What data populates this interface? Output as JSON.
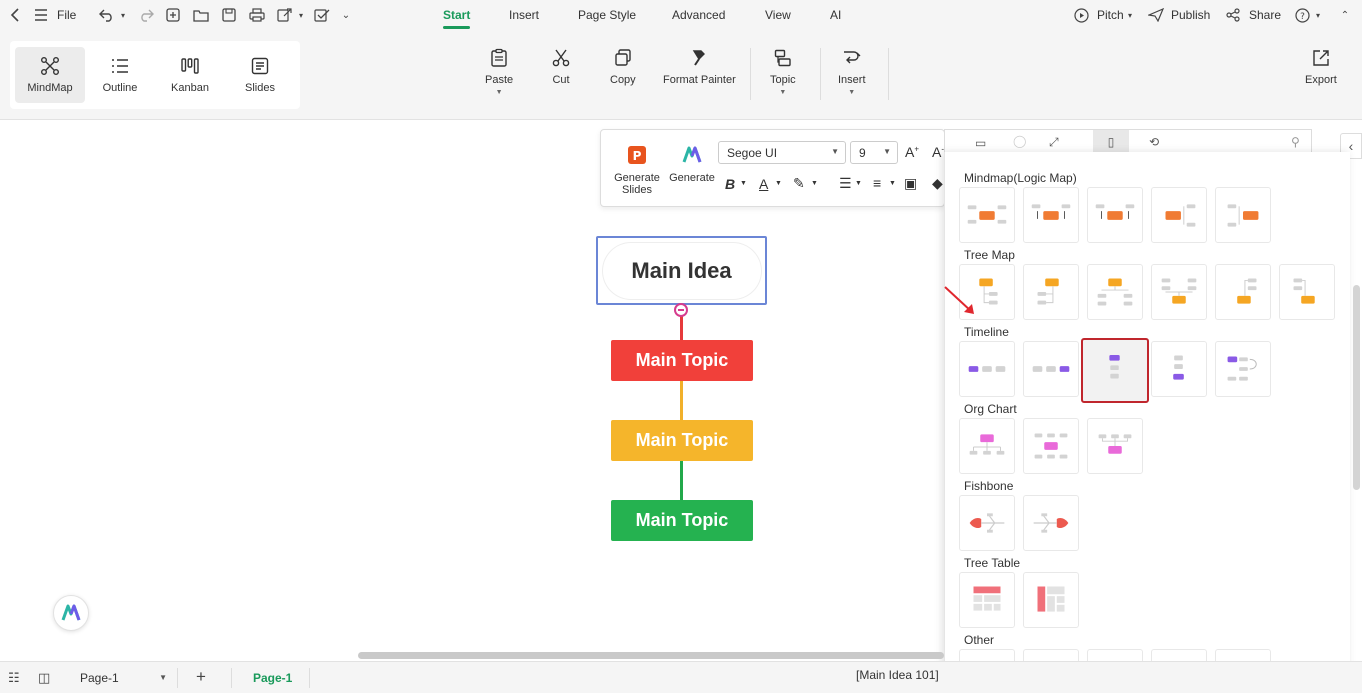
{
  "menu": {
    "file_label": "File",
    "tabs": [
      {
        "label": "Start",
        "active": true
      },
      {
        "label": "Insert"
      },
      {
        "label": "Page Style"
      },
      {
        "label": "Advanced"
      },
      {
        "label": "View"
      },
      {
        "label": "AI"
      }
    ],
    "pitch_label": "Pitch",
    "publish_label": "Publish",
    "share_label": "Share"
  },
  "views": [
    {
      "label": "MindMap",
      "icon": "mindmap-icon",
      "active": true
    },
    {
      "label": "Outline",
      "icon": "outline-icon"
    },
    {
      "label": "Kanban",
      "icon": "kanban-icon"
    },
    {
      "label": "Slides",
      "icon": "slides-icon"
    }
  ],
  "ribbon": {
    "paste": "Paste",
    "cut": "Cut",
    "copy": "Copy",
    "format_painter": "Format Painter",
    "topic": "Topic",
    "insert": "Insert",
    "export": "Export"
  },
  "floatbar": {
    "generate_slides": "Generate Slides",
    "generate": "Generate",
    "font": "Segoe UI",
    "size": "9"
  },
  "mindmap": {
    "main_idea": "Main Idea",
    "topics": [
      {
        "label": "Main Topic",
        "color": "#f1403a"
      },
      {
        "label": "Main Topic",
        "color": "#f5b52b"
      },
      {
        "label": "Main Topic",
        "color": "#25b250"
      }
    ],
    "line_colors": [
      "#e6393b",
      "#f1b02a",
      "#22a84a"
    ]
  },
  "layout_panel": {
    "sections": [
      {
        "title": "Mindmap(Logic Map)",
        "count": 5
      },
      {
        "title": "Tree Map",
        "count": 6
      },
      {
        "title": "Timeline",
        "count": 5,
        "selected_index": 2
      },
      {
        "title": "Org Chart",
        "count": 3
      },
      {
        "title": "Fishbone",
        "count": 2
      },
      {
        "title": "Tree Table",
        "count": 2
      },
      {
        "title": "Other",
        "count": 5
      }
    ]
  },
  "status": {
    "page_select": "Page-1",
    "page_tab": "Page-1",
    "selection_info": "[Main Idea 101]"
  }
}
